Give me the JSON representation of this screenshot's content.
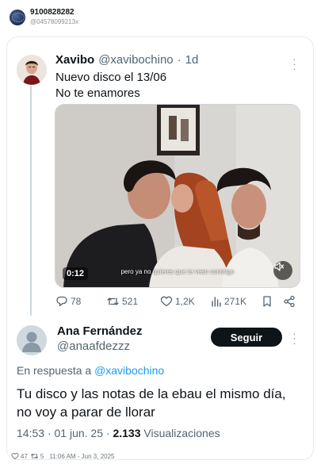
{
  "outer": {
    "name": "9100828282",
    "handle": "@04578099213x"
  },
  "tweet": {
    "name": "Xavibo",
    "handle": "@xavibochino",
    "separator": "·",
    "age": "1d",
    "lines": [
      "Nuevo disco el 13/06",
      "No te enamores"
    ],
    "video": {
      "duration": "0:12",
      "subtitle": "pero ya no quieres que te vean conmigo"
    },
    "stats": {
      "replies": "78",
      "retweets": "521",
      "likes": "1,2K",
      "views": "271K"
    }
  },
  "reply": {
    "name": "Ana Fernández",
    "handle": "@anaafdezzz",
    "follow_label": "Seguir",
    "reply_prefix": "En respuesta a",
    "reply_mention": "@xavibochino",
    "text_lines": [
      "Tu disco y las notas de la ebau el mismo día,",
      "no voy a parar de llorar"
    ],
    "time": "14:53",
    "separator": "·",
    "date": "01 jun. 25",
    "views_count": "2.133",
    "views_label": "Visualizaciones"
  },
  "footer": {
    "likes": "47",
    "retweets": "5",
    "timestamp": "11:06 AM - Jun 3, 2025"
  },
  "colors": {
    "accent": "#1d9bf0",
    "text": "#0f1419",
    "muted": "#536471",
    "border": "#e6e9ec"
  }
}
